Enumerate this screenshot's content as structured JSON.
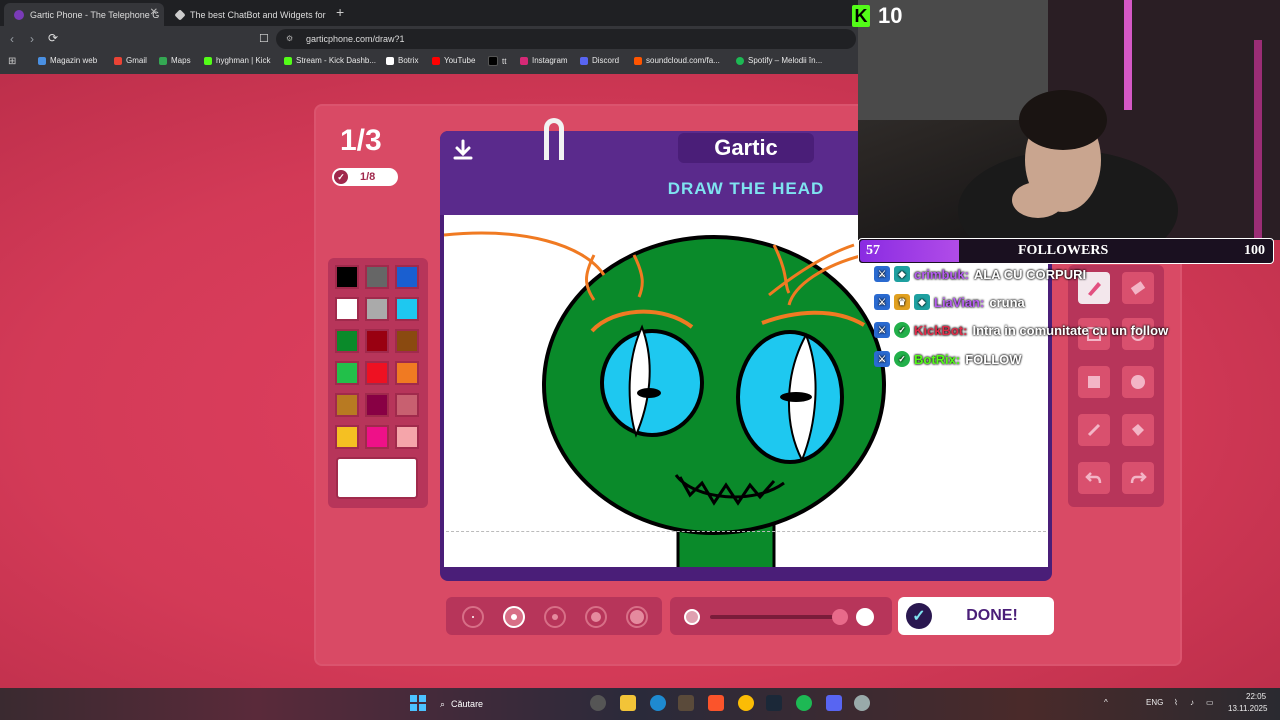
{
  "browser": {
    "tabs": [
      {
        "title": "Gartic Phone - The Telephone G",
        "active": true,
        "color": "#7a3bb8"
      },
      {
        "title": "The best ChatBot and Widgets for Ki",
        "active": false,
        "color": "#cccccc"
      }
    ],
    "url": "garticphone.com/draw?1",
    "bookmarks": [
      {
        "label": "Magazin web",
        "color": "#4a90e2"
      },
      {
        "label": "Gmail",
        "color": "#ea4335"
      },
      {
        "label": "Maps",
        "color": "#34a853"
      },
      {
        "label": "hyghman | Kick",
        "color": "#53fc18"
      },
      {
        "label": "Stream - Kick Dashb...",
        "color": "#53fc18"
      },
      {
        "label": "Botrix",
        "color": "#ffffff"
      },
      {
        "label": "YouTube",
        "color": "#ff0000"
      },
      {
        "label": "tt",
        "color": "#000000"
      },
      {
        "label": "Instagram",
        "color": "#d62976"
      },
      {
        "label": "Discord",
        "color": "#5865f2"
      },
      {
        "label": "soundcloud.com/fa...",
        "color": "#ff5500"
      },
      {
        "label": "Spotify – Melodii în...",
        "color": "#1db954"
      }
    ]
  },
  "game": {
    "round": "1/3",
    "players_done": "1/8",
    "brand": "Gartic",
    "instruction": "DRAW THE HEAD",
    "done_label": "DONE!",
    "palette": [
      "#000000",
      "#666666",
      "#1a5fd0",
      "#ffffff",
      "#aaaaaa",
      "#1ec8f0",
      "#0a8a2a",
      "#990011",
      "#8a4a10",
      "#22c04a",
      "#ee1122",
      "#f07a22",
      "#b87a22",
      "#880044",
      "#c86070",
      "#f5c022",
      "#ee1188",
      "#f5a5aa"
    ],
    "active_color": "#ffffff",
    "brush_sizes": 5,
    "selected_brush": 2,
    "opacity_percent": 100
  },
  "stream": {
    "kick_count": "10",
    "followers": {
      "label": "FOLLOWERS",
      "current": "57",
      "goal": "100",
      "fraction": 0.57
    },
    "chat": [
      {
        "user": "crimbuk:",
        "message": "ALA CU CORPURI",
        "color": "#b55cf0"
      },
      {
        "user": "LiaVian:",
        "message": "cruna",
        "color": "#b55cf0"
      },
      {
        "user": "KickBot:",
        "message": "Intra in comunitate cu un follow",
        "color": "#e02d4a"
      },
      {
        "user": "BotRix:",
        "message": "FOLLOW",
        "color": "#53fc18"
      }
    ]
  },
  "taskbar": {
    "search_placeholder": "Căutare",
    "lang": "ENG",
    "time": "22:05",
    "date": "13.11.2025"
  }
}
